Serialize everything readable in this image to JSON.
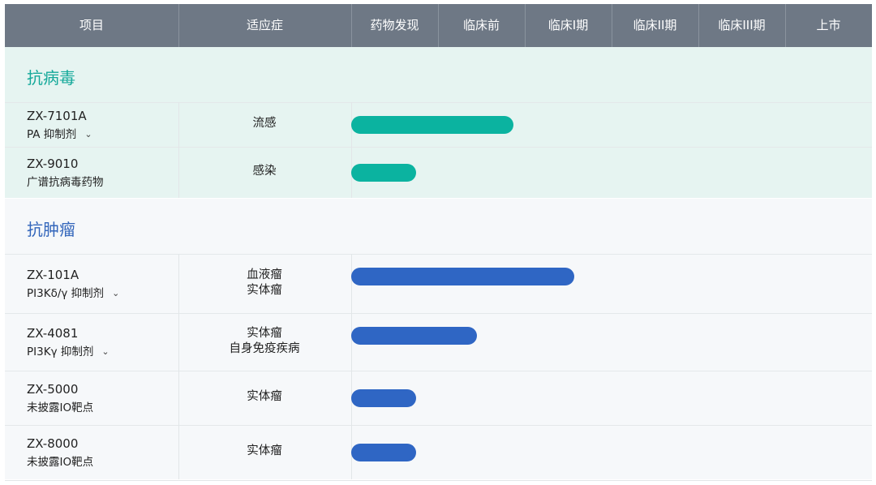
{
  "columns": {
    "project": "项目",
    "indication": "适应症",
    "stages": [
      "药物发现",
      "临床前",
      "临床I期",
      "临床II期",
      "临床III期",
      "上市"
    ]
  },
  "colors": {
    "header_bg": "#6e7885",
    "antiviral_bar": "#0bb3a0",
    "antiviral_title": "#15a99a",
    "oncology_bar": "#2f66c4",
    "oncology_title": "#3366bb",
    "antiviral_band": "#e6f4f1",
    "oncology_band": "#f6f8fa"
  },
  "chart_data": {
    "type": "bar",
    "orientation": "horizontal",
    "x_scale": "development stage, 0 = start of 药物发现 to 6 = end of 上市",
    "groups": [
      {
        "title": "抗病毒",
        "rows": [
          {
            "name": "ZX-7101A",
            "sub": "PA 抑制剂",
            "expandable": true,
            "indication": [
              "流感"
            ],
            "progress": 1.87
          },
          {
            "name": "ZX-9010",
            "sub": "广谱抗病毒药物",
            "expandable": false,
            "indication": [
              "感染"
            ],
            "progress": 0.75
          }
        ]
      },
      {
        "title": "抗肿瘤",
        "rows": [
          {
            "name": "ZX-101A",
            "sub": "PI3Kδ/γ 抑制剂",
            "expandable": true,
            "indication": [
              "血液瘤",
              "实体瘤"
            ],
            "progress": 2.57
          },
          {
            "name": "ZX-4081",
            "sub": "PI3Kγ 抑制剂",
            "expandable": true,
            "indication": [
              "实体瘤",
              "自身免疫疾病"
            ],
            "progress": 1.45
          },
          {
            "name": "ZX-5000",
            "sub": "未披露IO靶点",
            "expandable": false,
            "indication": [
              "实体瘤"
            ],
            "progress": 0.75
          },
          {
            "name": "ZX-8000",
            "sub": "未披露IO靶点",
            "expandable": false,
            "indication": [
              "实体瘤"
            ],
            "progress": 0.75
          }
        ]
      }
    ]
  }
}
